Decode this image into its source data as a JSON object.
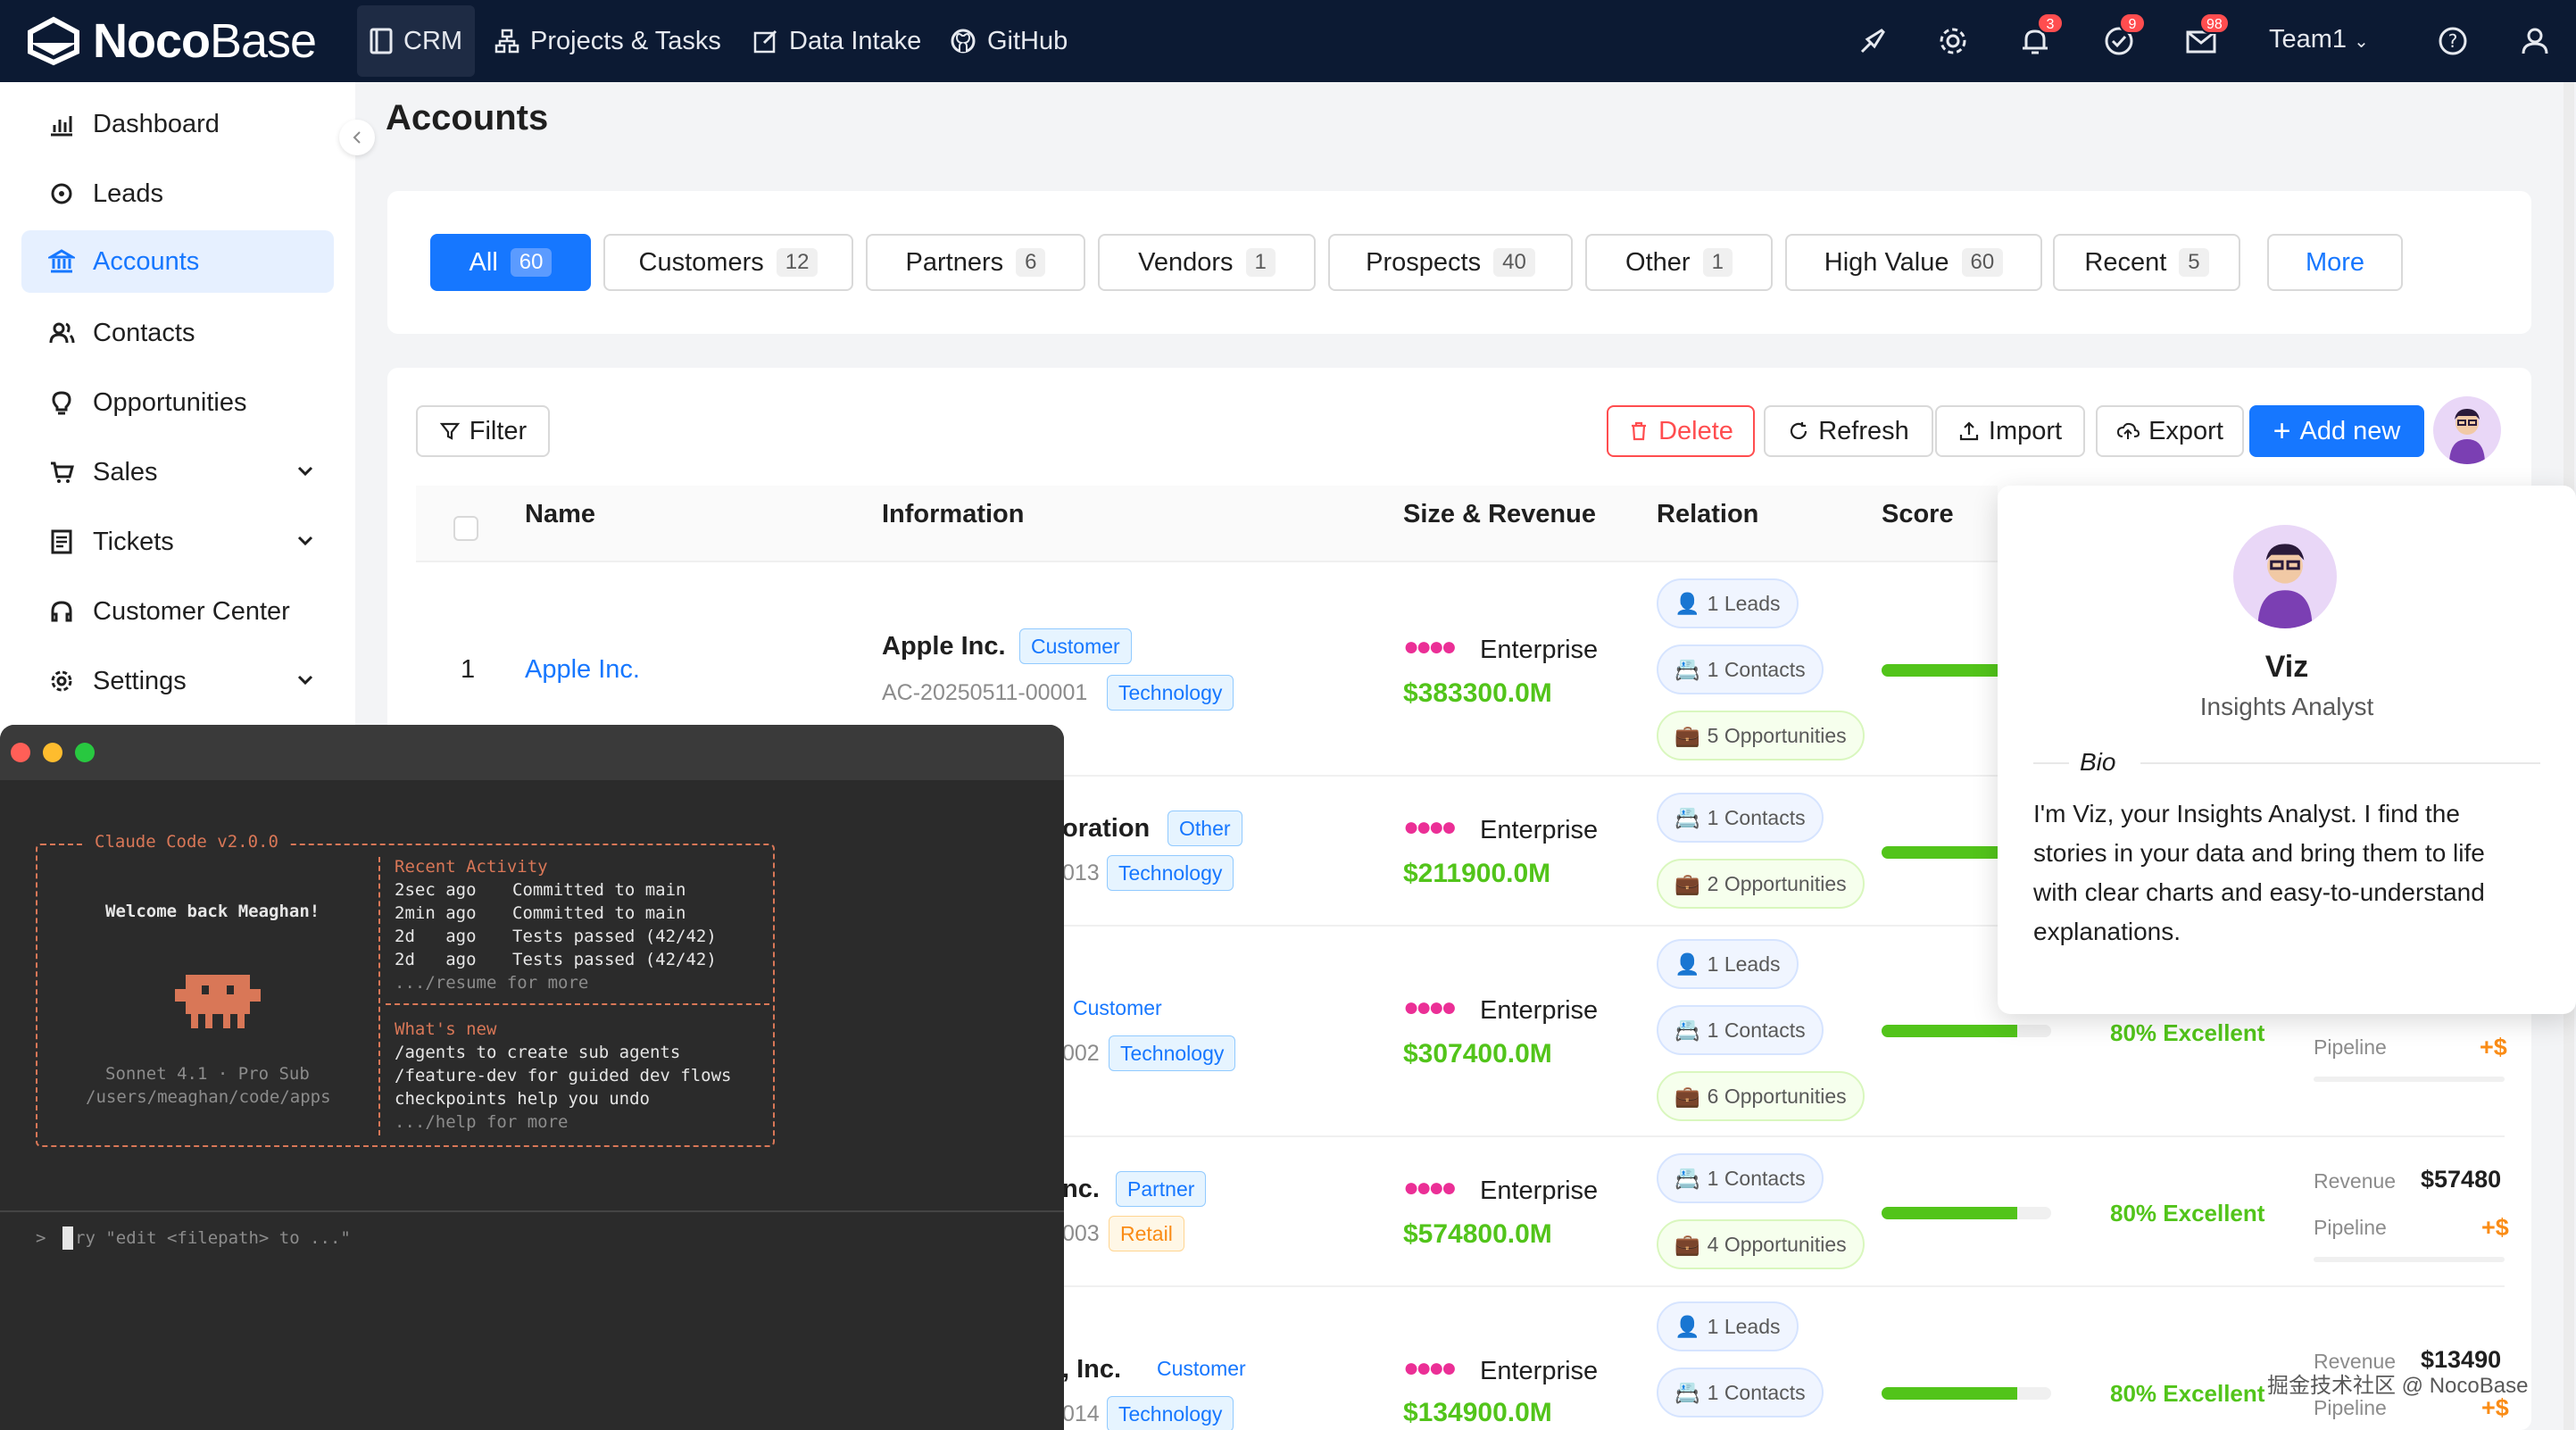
{
  "brand": {
    "name_bold": "Noco",
    "name_light": "Base"
  },
  "nav": [
    {
      "label": "CRM",
      "icon": "book-icon"
    },
    {
      "label": "Projects & Tasks",
      "icon": "hierarchy-icon"
    },
    {
      "label": "Data Intake",
      "icon": "edit-square-icon"
    },
    {
      "label": "GitHub",
      "icon": "github-icon"
    }
  ],
  "topbar": {
    "badges": [
      "3",
      "9",
      "98"
    ],
    "team": "Team1"
  },
  "sidebar": {
    "items": [
      {
        "label": "Dashboard",
        "icon": "chart-icon"
      },
      {
        "label": "Leads",
        "icon": "target-icon"
      },
      {
        "label": "Accounts",
        "icon": "bank-icon"
      },
      {
        "label": "Contacts",
        "icon": "users-icon"
      },
      {
        "label": "Opportunities",
        "icon": "bulb-icon"
      },
      {
        "label": "Sales",
        "icon": "cart-icon"
      },
      {
        "label": "Tickets",
        "icon": "ticket-icon"
      },
      {
        "label": "Customer Center",
        "icon": "headset-icon"
      },
      {
        "label": "Settings",
        "icon": "gear-icon"
      }
    ]
  },
  "page": {
    "title": "Accounts"
  },
  "tabs": [
    {
      "label": "All",
      "count": "60"
    },
    {
      "label": "Customers",
      "count": "12"
    },
    {
      "label": "Partners",
      "count": "6"
    },
    {
      "label": "Vendors",
      "count": "1"
    },
    {
      "label": "Prospects",
      "count": "40"
    },
    {
      "label": "Other",
      "count": "1"
    },
    {
      "label": "High Value",
      "count": "60"
    },
    {
      "label": "Recent",
      "count": "5"
    },
    {
      "label": "More",
      "count": ""
    }
  ],
  "toolbar": {
    "filter": "Filter",
    "delete": "Delete",
    "refresh": "Refresh",
    "import": "Import",
    "export": "Export",
    "add_new": "Add new"
  },
  "table": {
    "headers": [
      "Name",
      "Information",
      "Size & Revenue",
      "Relation",
      "Score"
    ],
    "rows": [
      {
        "index": "1",
        "name": "Apple Inc.",
        "info_name": "Apple Inc.",
        "info_type": "Customer",
        "info_code": "AC-20250511-00001",
        "info_industry": "Technology",
        "size": "Enterprise",
        "revenue": "$383300.0M",
        "relations": [
          "1 Leads",
          "1 Contacts",
          "5 Opportunities"
        ]
      },
      {
        "index": "",
        "name": "",
        "info_name": "oration",
        "info_type": "Other",
        "info_code": "013",
        "info_industry": "Technology",
        "size": "Enterprise",
        "revenue": "$211900.0M",
        "relations": [
          "1 Contacts",
          "2 Opportunities"
        ]
      },
      {
        "index": "",
        "name": "",
        "info_name": "",
        "info_type": "Customer",
        "info_code": "002",
        "info_industry": "Technology",
        "size": "Enterprise",
        "revenue": "$307400.0M",
        "relations": [
          "1 Leads",
          "1 Contacts",
          "6 Opportunities"
        ],
        "score": "80% Excellent",
        "score_fraction": 0.8,
        "pipeline_label": "Pipeline",
        "pipeline_value": "+$"
      },
      {
        "index": "",
        "name": "",
        "info_name": "nc.",
        "info_type": "Partner",
        "info_code": "003",
        "info_industry": "Retail",
        "size": "Enterprise",
        "revenue": "$574800.0M",
        "relations": [
          "1 Contacts",
          "4 Opportunities"
        ],
        "score": "80% Excellent",
        "score_fraction": 0.8,
        "revenue_label": "Revenue",
        "revenue_value": "$57480",
        "pipeline_label": "Pipeline",
        "pipeline_value": "+$"
      },
      {
        "index": "",
        "name": "",
        "info_name": ", Inc.",
        "info_type": "Customer",
        "info_code": "014",
        "info_industry": "Technology",
        "size": "Enterprise",
        "revenue": "$134900.0M",
        "relations": [
          "1 Leads",
          "1 Contacts"
        ],
        "score": "80% Excellent",
        "score_fraction": 0.8,
        "revenue_label": "Revenue",
        "revenue_value": "$13490",
        "pipeline_label": "Pipeline",
        "pipeline_value": "+$"
      }
    ]
  },
  "popup": {
    "name": "Viz",
    "role": "Insights Analyst",
    "bio_label": "Bio",
    "bio": [
      "I'm Viz, your Insights Analyst. I find the",
      "stories in your data and bring them to life",
      "with clear charts and easy-to-understand",
      "explanations."
    ]
  },
  "terminal": {
    "box_title": "Claude Code v2.0.0",
    "welcome": "Welcome back Meaghan!",
    "model": "Sonnet 4.1 · Pro Sub",
    "path": "/users/meaghan/code/apps",
    "recent_title": "Recent Activity",
    "recent": [
      {
        "when": "2sec ago",
        "what": "Committed to main"
      },
      {
        "when": "2min ago",
        "what": "Committed to main"
      },
      {
        "when": "2d   ago",
        "what": "Tests passed (42/42)"
      },
      {
        "when": "2d   ago",
        "what": "Tests passed (42/42)"
      }
    ],
    "recent_more": ".../resume for more",
    "whats_new_title": "What's new",
    "whats_new": [
      "/agents to create sub agents",
      "/feature-dev for guided dev flows",
      "checkpoints help you undo"
    ],
    "whats_new_more": ".../help for more",
    "prompt": ">",
    "input_placeholder": "ry \"edit <filepath> to ...\""
  },
  "watermark": "掘金技术社区 @ NocoBase"
}
